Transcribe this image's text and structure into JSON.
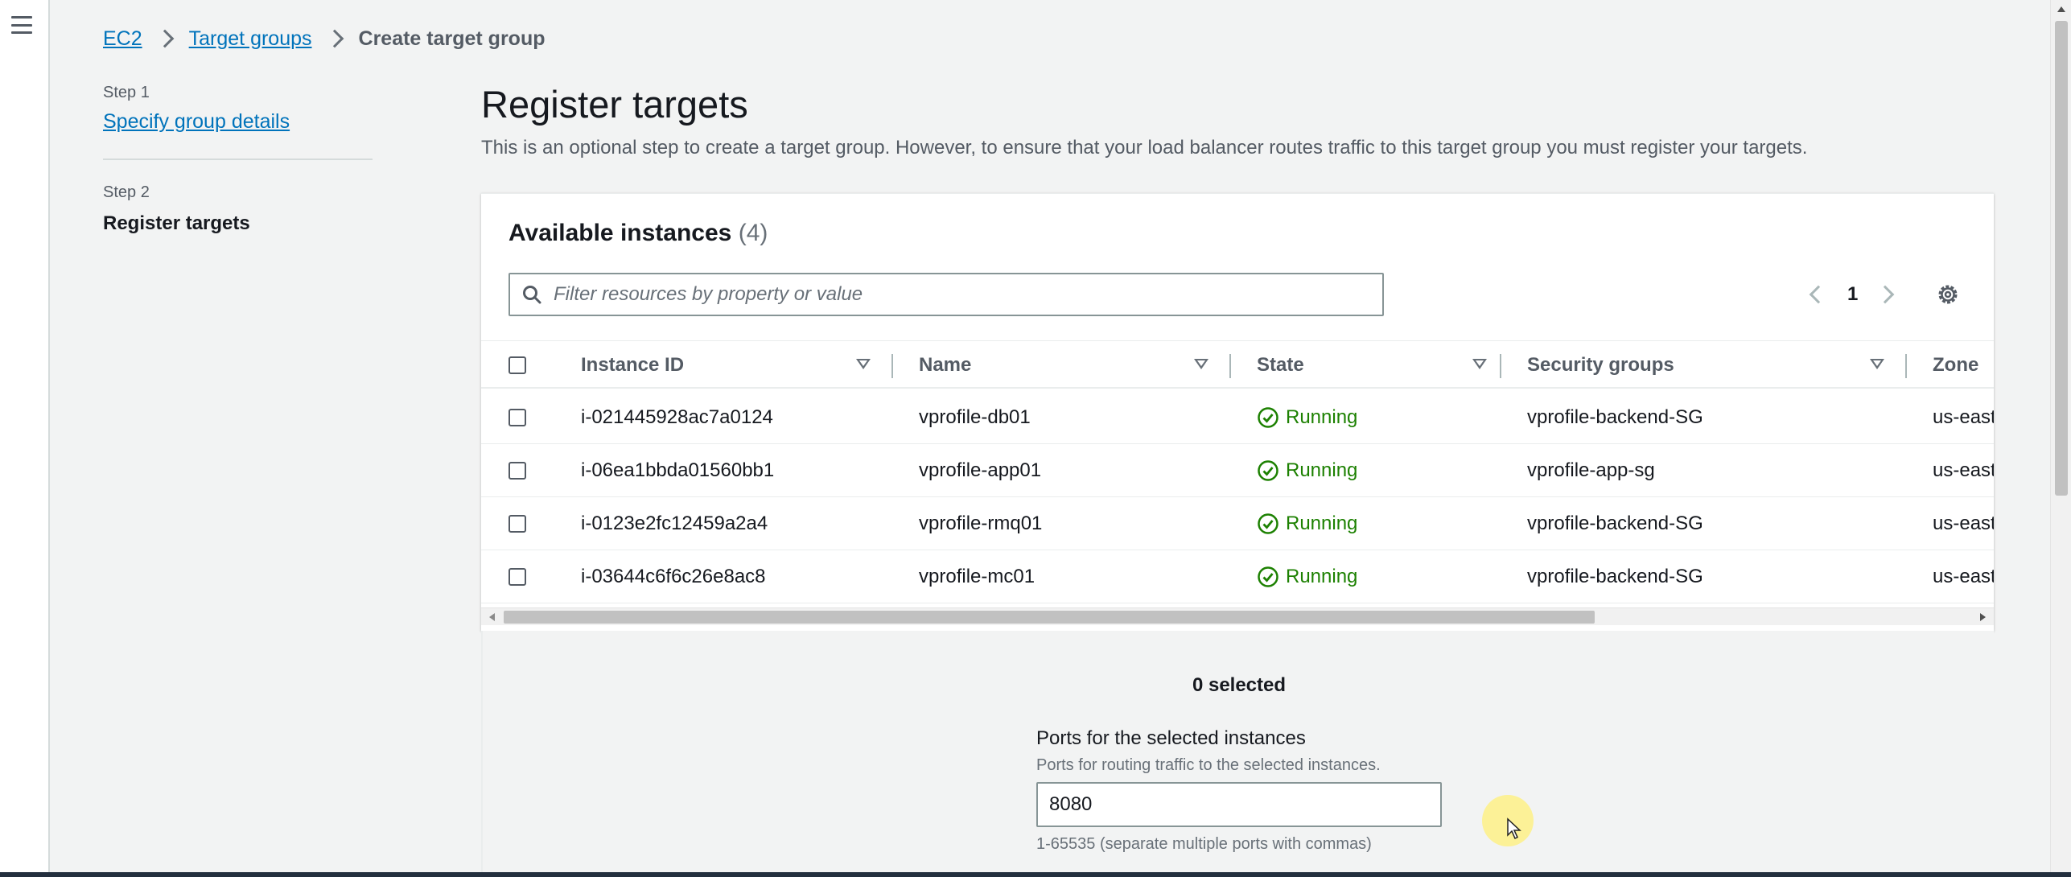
{
  "breadcrumb": {
    "items": [
      {
        "label": "EC2"
      },
      {
        "label": "Target groups"
      },
      {
        "label": "Create target group"
      }
    ]
  },
  "steps": [
    {
      "step_label": "Step 1",
      "title": "Specify group details"
    },
    {
      "step_label": "Step 2",
      "title": "Register targets"
    }
  ],
  "page": {
    "title": "Register targets",
    "description": "This is an optional step to create a target group. However, to ensure that your load balancer routes traffic to this target group you must register your targets."
  },
  "instances_panel": {
    "title": "Available instances",
    "count": "(4)",
    "filter_placeholder": "Filter resources by property or value",
    "current_page": "1",
    "columns": [
      "Instance ID",
      "Name",
      "State",
      "Security groups",
      "Zone"
    ],
    "rows": [
      {
        "instance_id": "i-021445928ac7a0124",
        "name": "vprofile-db01",
        "state": "Running",
        "security_group": "vprofile-backend-SG",
        "zone": "us-east"
      },
      {
        "instance_id": "i-06ea1bbda01560bb1",
        "name": "vprofile-app01",
        "state": "Running",
        "security_group": "vprofile-app-sg",
        "zone": "us-east"
      },
      {
        "instance_id": "i-0123e2fc12459a2a4",
        "name": "vprofile-rmq01",
        "state": "Running",
        "security_group": "vprofile-backend-SG",
        "zone": "us-east"
      },
      {
        "instance_id": "i-03644c6f6c26e8ac8",
        "name": "vprofile-mc01",
        "state": "Running",
        "security_group": "vprofile-backend-SG",
        "zone": "us-east"
      }
    ]
  },
  "selection": {
    "selected_text": "0 selected",
    "ports_label": "Ports for the selected instances",
    "ports_description": "Ports for routing traffic to the selected instances.",
    "ports_value": "8080",
    "ports_hint": "1-65535 (separate multiple ports with commas)"
  },
  "icons": {
    "menu": "hamburger-menu-icon",
    "search": "search-icon",
    "settings": "gear-icon",
    "state": "check-circle-icon",
    "sort": "caret-down-icon"
  },
  "colors": {
    "link": "#0073bb",
    "running": "#1d8102",
    "text": "#16191f",
    "muted": "#545b64",
    "background": "#f2f3f3"
  }
}
